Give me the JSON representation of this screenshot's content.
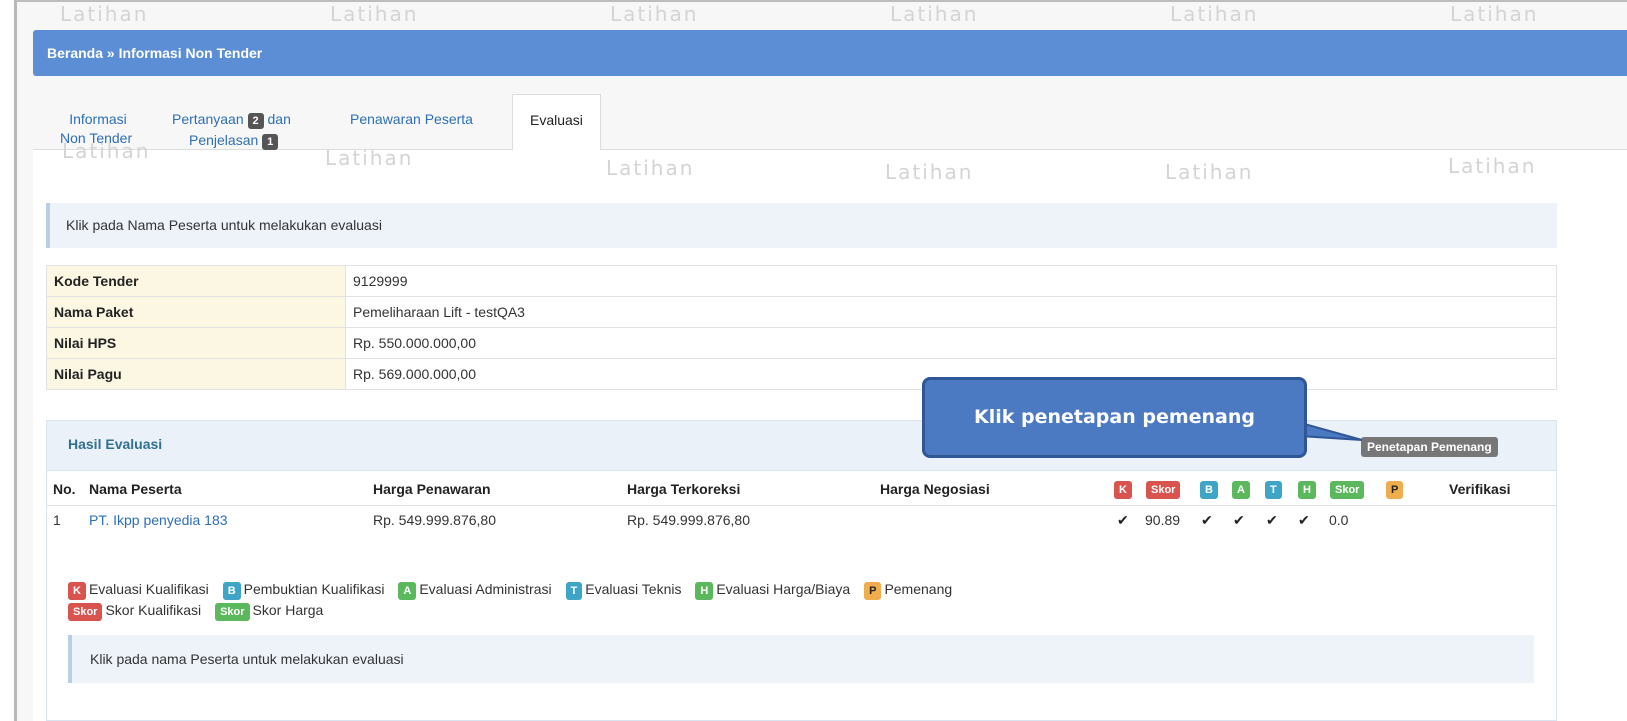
{
  "watermark_text": "Latihan",
  "breadcrumb": "Beranda » Informasi Non Tender",
  "tabs": {
    "info_line1": "Informasi",
    "info_line2": "Non Tender",
    "tanya_line1a": "Pertanyaan",
    "tanya_badge1": "2",
    "tanya_line1b": "dan",
    "tanya_line2": "Penjelasan",
    "tanya_badge2": "1",
    "penawaran": "Penawaran Peserta",
    "evaluasi": "Evaluasi"
  },
  "info_message": "Klik pada Nama Peserta untuk melakukan evaluasi",
  "details": [
    {
      "label": "Kode Tender",
      "value": "9129999"
    },
    {
      "label": "Nama Paket",
      "value": "Pemeliharaan Lift - testQA3"
    },
    {
      "label": "Nilai HPS",
      "value": "Rp. 550.000.000,00"
    },
    {
      "label": "Nilai Pagu",
      "value": "Rp. 569.000.000,00"
    }
  ],
  "hasil": {
    "title": "Hasil Evaluasi",
    "button": "Penetapan Pemenang",
    "columns": {
      "no": "No.",
      "nama": "Nama Peserta",
      "harga_penawaran": "Harga Penawaran",
      "harga_terkoreksi": "Harga Terkoreksi",
      "harga_negosiasi": "Harga Negosiasi",
      "k": "K",
      "skor1": "Skor",
      "b": "B",
      "a": "A",
      "t": "T",
      "h": "H",
      "skor2": "Skor",
      "p": "P",
      "verifikasi": "Verifikasi"
    },
    "rows": [
      {
        "no": "1",
        "nama": "PT. Ikpp penyedia 183",
        "harga_penawaran": "Rp. 549.999.876,80",
        "harga_terkoreksi": "Rp. 549.999.876,80",
        "harga_negosiasi": "",
        "k": "✔",
        "skor_kualifikasi": "90.89",
        "b": "✔",
        "a": "✔",
        "t": "✔",
        "h": "✔",
        "skor_harga": "0.0",
        "p": "",
        "verifikasi": ""
      }
    ]
  },
  "legend": {
    "k_label": "K",
    "k_text": "Evaluasi Kualifikasi",
    "b_label": "B",
    "b_text": "Pembuktian Kualifikasi",
    "a_label": "A",
    "a_text": "Evaluasi Administrasi",
    "t_label": "T",
    "t_text": "Evaluasi Teknis",
    "h_label": "H",
    "h_text": "Evaluasi Harga/Biaya",
    "p_label": "P",
    "p_text": "Pemenang",
    "skor1_label": "Skor",
    "skor1_text": "Skor Kualifikasi",
    "skor2_label": "Skor",
    "skor2_text": "Skor Harga"
  },
  "info_message2": "Klik pada nama Peserta untuk melakukan evaluasi",
  "callout": "Klik penetapan pemenang",
  "colors": {
    "topbar": "#5b8ed4",
    "link": "#2d6fb5",
    "label_red": "#d9534f",
    "label_blue": "#3fa5c6",
    "label_green": "#5cb85c",
    "label_yellow": "#f0ad4e",
    "callout": "#4b79c2"
  }
}
